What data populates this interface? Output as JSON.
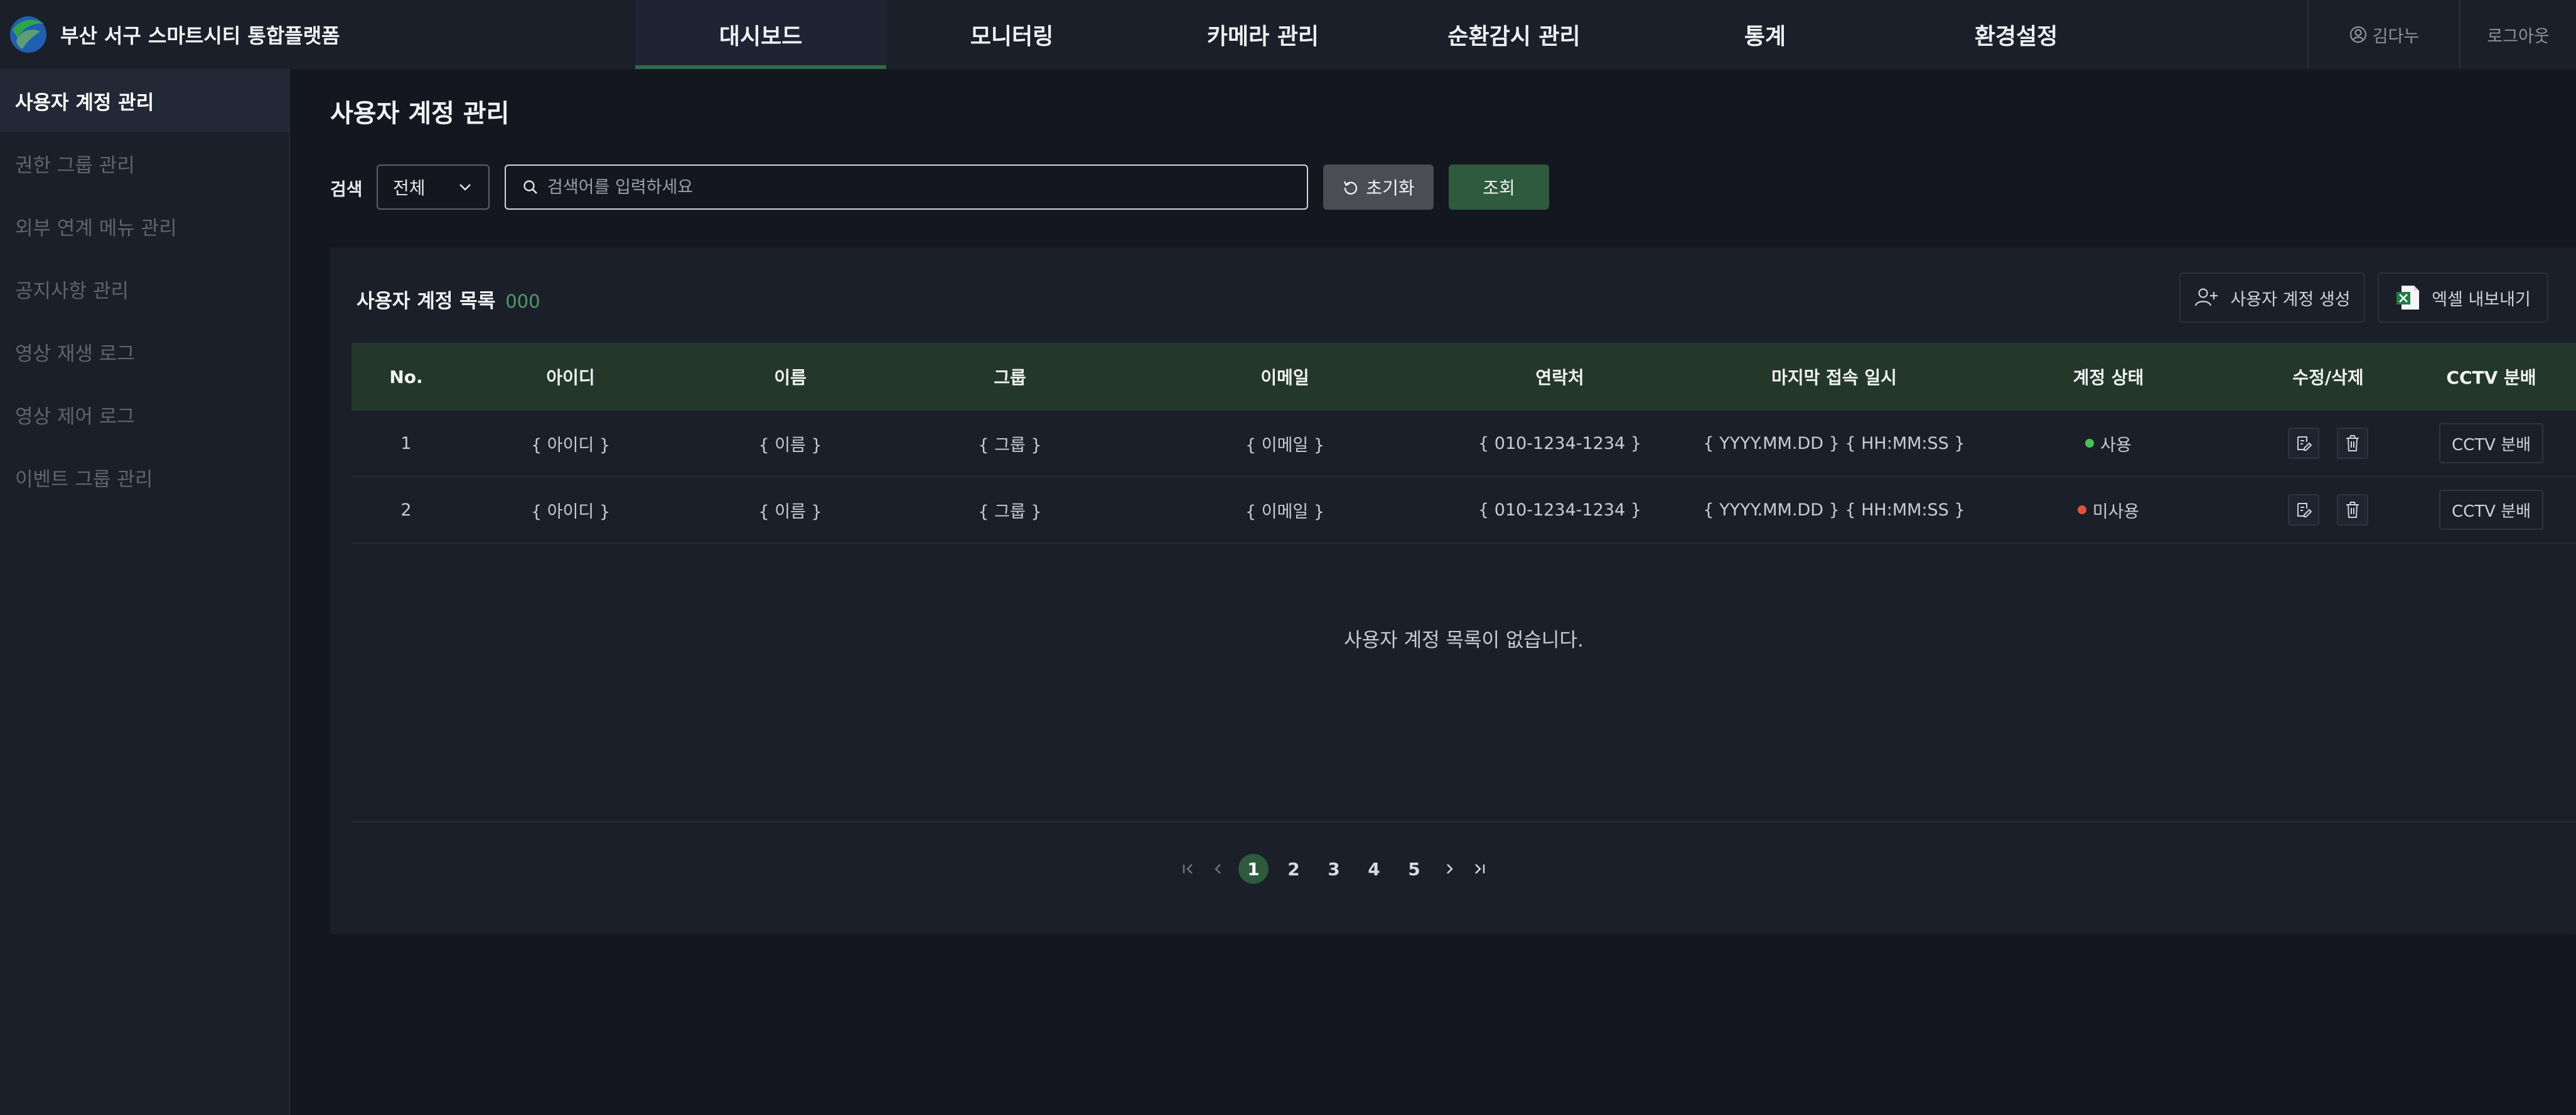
{
  "header": {
    "brand_name": "부산 서구 스마트시티 통합플랫폼",
    "nav": [
      "대시보드",
      "모니터링",
      "카메라 관리",
      "순환감시 관리",
      "통계",
      "환경설정"
    ],
    "active_nav": "대시보드",
    "user_name": "김다누",
    "logout_label": "로그아웃"
  },
  "sidebar": {
    "items": [
      {
        "label": "사용자 계정 관리",
        "active": true
      },
      {
        "label": "권한 그룹 관리",
        "active": false
      },
      {
        "label": "외부 연계 메뉴 관리",
        "active": false
      },
      {
        "label": "공지사항 관리",
        "active": false
      },
      {
        "label": "영상 재생 로그",
        "active": false
      },
      {
        "label": "영상 제어 로그",
        "active": false
      },
      {
        "label": "이벤트 그룹 관리",
        "active": false
      }
    ]
  },
  "main": {
    "title": "사용자 계정 관리",
    "search_label": "검색",
    "select_value": "전체",
    "search_placeholder": "검색어를 입력하세요",
    "reset_label": "초기화",
    "search_button_label": "조회"
  },
  "list": {
    "title": "사용자 계정 목록",
    "count": "000",
    "create_label": "사용자 계정 생성",
    "excel_label": "엑셀 내보내기",
    "columns": [
      "No.",
      "아이디",
      "이름",
      "그룹",
      "이메일",
      "연락처",
      "마지막 접속 일시",
      "계정 상태",
      "수정/삭제",
      "CCTV 분배"
    ],
    "rows": [
      {
        "no": "1",
        "id": "{ 아이디 }",
        "name": "{ 이름 }",
        "group": "{ 그룹 }",
        "email": "{ 이메일 }",
        "phone": "{ 010-1234-1234 }",
        "last_login": "{ YYYY.MM.DD } { HH:MM:SS }",
        "status": "사용",
        "status_color": "#4bbf5a",
        "cctv": "CCTV 분배"
      },
      {
        "no": "2",
        "id": "{ 아이디 }",
        "name": "{ 이름 }",
        "group": "{ 그룹 }",
        "email": "{ 이메일 }",
        "phone": "{ 010-1234-1234 }",
        "last_login": "{ YYYY.MM.DD } { HH:MM:SS }",
        "status": "미사용",
        "status_color": "#e0533a",
        "cctv": "CCTV 분배"
      }
    ],
    "empty_message": "사용자 계정 목록이 없습니다."
  },
  "pagination": {
    "pages": [
      "1",
      "2",
      "3",
      "4",
      "5"
    ],
    "current": "1"
  },
  "colors": {
    "accent": "#2e5a3d",
    "table_header": "#23382b",
    "count": "#4f9c66"
  }
}
